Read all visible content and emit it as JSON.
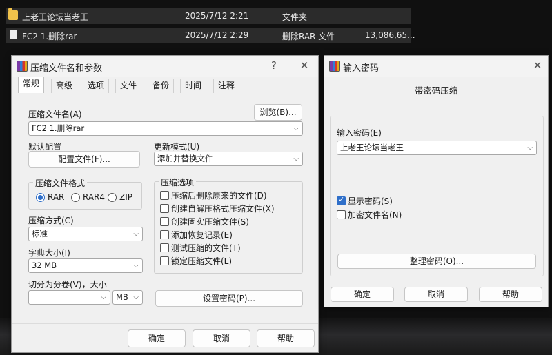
{
  "file_list": {
    "rows": [
      {
        "name": "上老王论坛当老王",
        "date": "2025/7/12 2:21",
        "type": "文件夹",
        "size": ""
      },
      {
        "name": "FC2 1.删除rar",
        "date": "2025/7/12 2:29",
        "type": "删除RAR 文件",
        "size": "13,086,65..."
      }
    ]
  },
  "archive_dialog": {
    "title": "压缩文件名和参数",
    "help_glyph": "?",
    "close_glyph": "✕",
    "tabs": [
      "常规",
      "高级",
      "选项",
      "文件",
      "备份",
      "时间",
      "注释"
    ],
    "archive_name_label": "压缩文件名(A)",
    "browse_label": "浏览(B)...",
    "archive_name_value": "FC2 1.删除rar",
    "default_profile_label": "默认配置",
    "profiles_button": "配置文件(F)...",
    "update_mode_label": "更新模式(U)",
    "update_mode_value": "添加并替换文件",
    "format_group_title": "压缩文件格式",
    "formats": [
      "RAR",
      "RAR4",
      "ZIP"
    ],
    "selected_format": "RAR",
    "options_group_title": "压缩选项",
    "options": [
      {
        "label": "压缩后删除原来的文件(D)",
        "checked": false
      },
      {
        "label": "创建自解压格式压缩文件(X)",
        "checked": false
      },
      {
        "label": "创建固实压缩文件(S)",
        "checked": false
      },
      {
        "label": "添加恢复记录(E)",
        "checked": false
      },
      {
        "label": "测试压缩的文件(T)",
        "checked": false
      },
      {
        "label": "锁定压缩文件(L)",
        "checked": false
      }
    ],
    "method_label": "压缩方式(C)",
    "method_value": "标准",
    "dict_label": "字典大小(I)",
    "dict_value": "32 MB",
    "split_label": "切分为分卷(V)，大小",
    "split_value": "",
    "split_unit": "MB",
    "set_password_button": "设置密码(P)...",
    "ok": "确定",
    "cancel": "取消",
    "help": "帮助"
  },
  "password_dialog": {
    "title": "输入密码",
    "close_glyph": "✕",
    "heading": "带密码压缩",
    "enter_password_label": "输入密码(E)",
    "password_value": "上老王论坛当老王",
    "show_password_label": "显示密码(S)",
    "show_password_checked": true,
    "encrypt_names_label": "加密文件名(N)",
    "encrypt_names_checked": false,
    "organize_button": "整理密码(O)...",
    "ok": "确定",
    "cancel": "取消",
    "help": "帮助"
  }
}
